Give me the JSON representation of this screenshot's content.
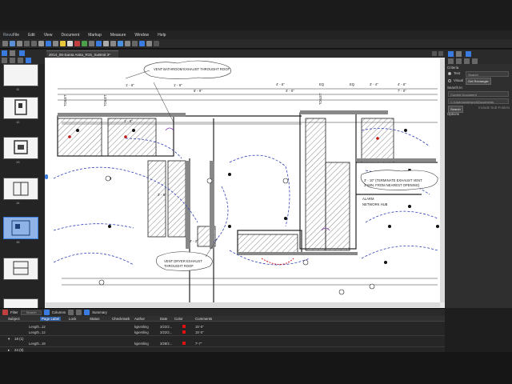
{
  "menubar": {
    "logo": "Revu",
    "items": [
      "File",
      "Edit",
      "View",
      "Document",
      "Markup",
      "Measure",
      "Window",
      "Help"
    ]
  },
  "document": {
    "tab_title": "2014_06-Santa Anita_R15_SuBmit 3*"
  },
  "thumbnails": {
    "labels": [
      "11",
      "12",
      "13",
      "14",
      "15"
    ],
    "selected": "14"
  },
  "drawing": {
    "notes": {
      "top": "VENT BATHROOM EXHAUST THROUGHT ROOF",
      "right_1": "3' - 10\" (TERMINATE EXHAUST VENT",
      "right_2": "3' MIN. FROM NEAREST OPENING)",
      "alarm": "ALARM",
      "network": "NETWORK HUB",
      "bottom_1": "VENT DRYER EXHAUST",
      "bottom_2": "THROUGHT ROOF"
    },
    "dims": {
      "d1": "1' - 6\"",
      "d2": "1' - 6\"",
      "d3": "4' - 6\"",
      "d4": "4' - 6\"",
      "d5": "3' - 4\"",
      "d6": "6' - 9\"",
      "d7": "EQ",
      "d8": "EQ",
      "d9": "1' - 6\"",
      "d10": "3' - 6\"",
      "d11": "4' - 2\"",
      "d12": "3' - 0\"",
      "d13": "7' - 0\""
    },
    "labels": {
      "toilet_1": "TOILET",
      "toilet_2": "TOILET",
      "toilet_3": "TOILET"
    }
  },
  "search_panel": {
    "section": "Criteria",
    "text_label": "Text",
    "visual_label": "Visual",
    "search_placeholder": "Search",
    "get_rect_button": "Get Rectangle",
    "search_in_label": "Search In",
    "search_in_value": "Current Document",
    "path_value": "C:\\Users\\kgiersing\\Documents",
    "search_button": "Search",
    "include_subfolders": "Include Sub-Folders",
    "options_label": "Options"
  },
  "markup_toolbar": {
    "filter": "Filter",
    "search": "Search",
    "columns": "Columns",
    "summary": "Summary"
  },
  "markup_list": {
    "headers": [
      "Subject",
      "Page Label",
      "Lock",
      "Status",
      "Checkmark",
      "Author",
      "Date",
      "Color",
      "Comments"
    ],
    "selected_header": "Page Label",
    "rows": [
      {
        "subject": "Length...",
        "page": "12",
        "author": "kgiersling",
        "date": "3/22/2...",
        "comment": "15'-0\""
      },
      {
        "subject": "Length...",
        "page": "12",
        "author": "kgiersling",
        "date": "3/22/2...",
        "comment": "15'-0\""
      }
    ],
    "group_1": "18 (1)",
    "group_1_row": {
      "subject": "Length...",
      "page": "18",
      "author": "kgiersling",
      "date": "3/28/2...",
      "comment": "7'-7\""
    },
    "group_2": "24 (0)",
    "red": "#e01010"
  }
}
